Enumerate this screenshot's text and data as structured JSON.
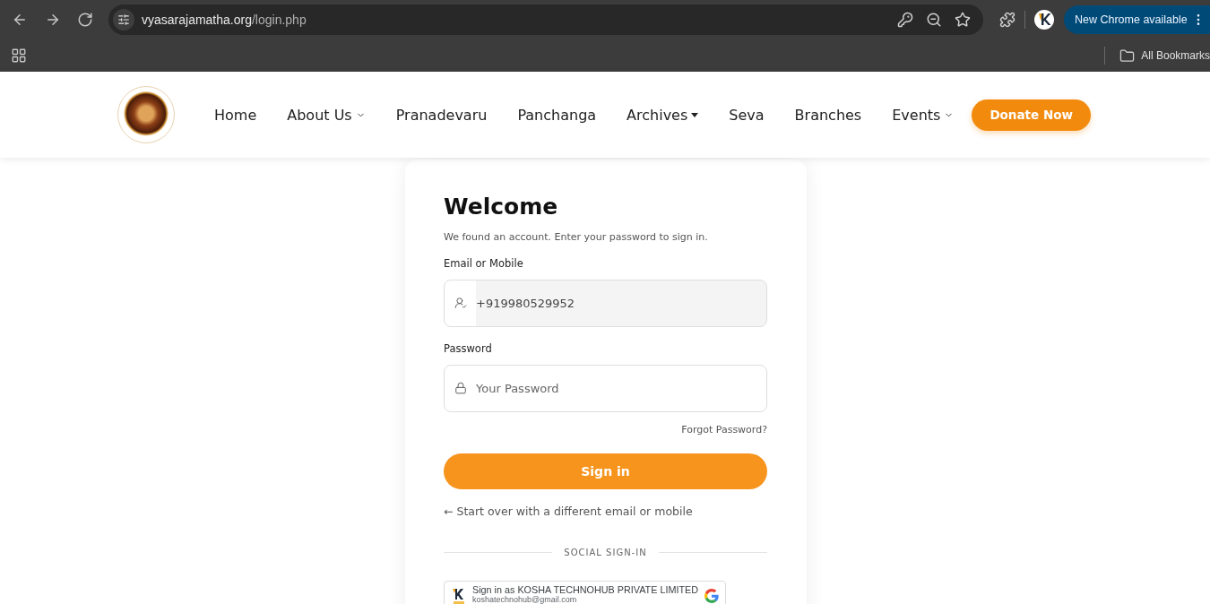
{
  "browser": {
    "address": {
      "domain": "vyasarajamatha.org",
      "path": "/login.php"
    },
    "update_button": "New Chrome available",
    "bookmarks": {
      "all_bookmarks": "All Bookmarks"
    }
  },
  "header": {
    "nav": [
      {
        "label": "Home",
        "kind": "link"
      },
      {
        "label": "About Us",
        "kind": "chevron"
      },
      {
        "label": "Pranadevaru",
        "kind": "link"
      },
      {
        "label": "Panchanga",
        "kind": "link"
      },
      {
        "label": "Archives",
        "kind": "caret"
      },
      {
        "label": "Seva",
        "kind": "link"
      },
      {
        "label": "Branches",
        "kind": "link"
      },
      {
        "label": "Events",
        "kind": "chevron"
      }
    ],
    "donate_button": "Donate Now"
  },
  "login_card": {
    "title": "Welcome",
    "subtitle": "We found an account. Enter your password to sign in.",
    "fields": [
      {
        "label": "Email or Mobile",
        "kind": "identity",
        "value": "+919980529952"
      },
      {
        "label": "Password",
        "kind": "password",
        "placeholder": "Your Password"
      }
    ],
    "forgot_link": "Forgot Password?",
    "submit_button": "Sign in",
    "start_over_link": "← Start over with a different email or mobile",
    "divider": "SOCIAL SIGN-IN",
    "google_button": {
      "title": "Sign in as KOSHA TECHNOHUB PRIVATE LIMITED",
      "email": "koshatechnohub@gmail.com"
    }
  }
}
